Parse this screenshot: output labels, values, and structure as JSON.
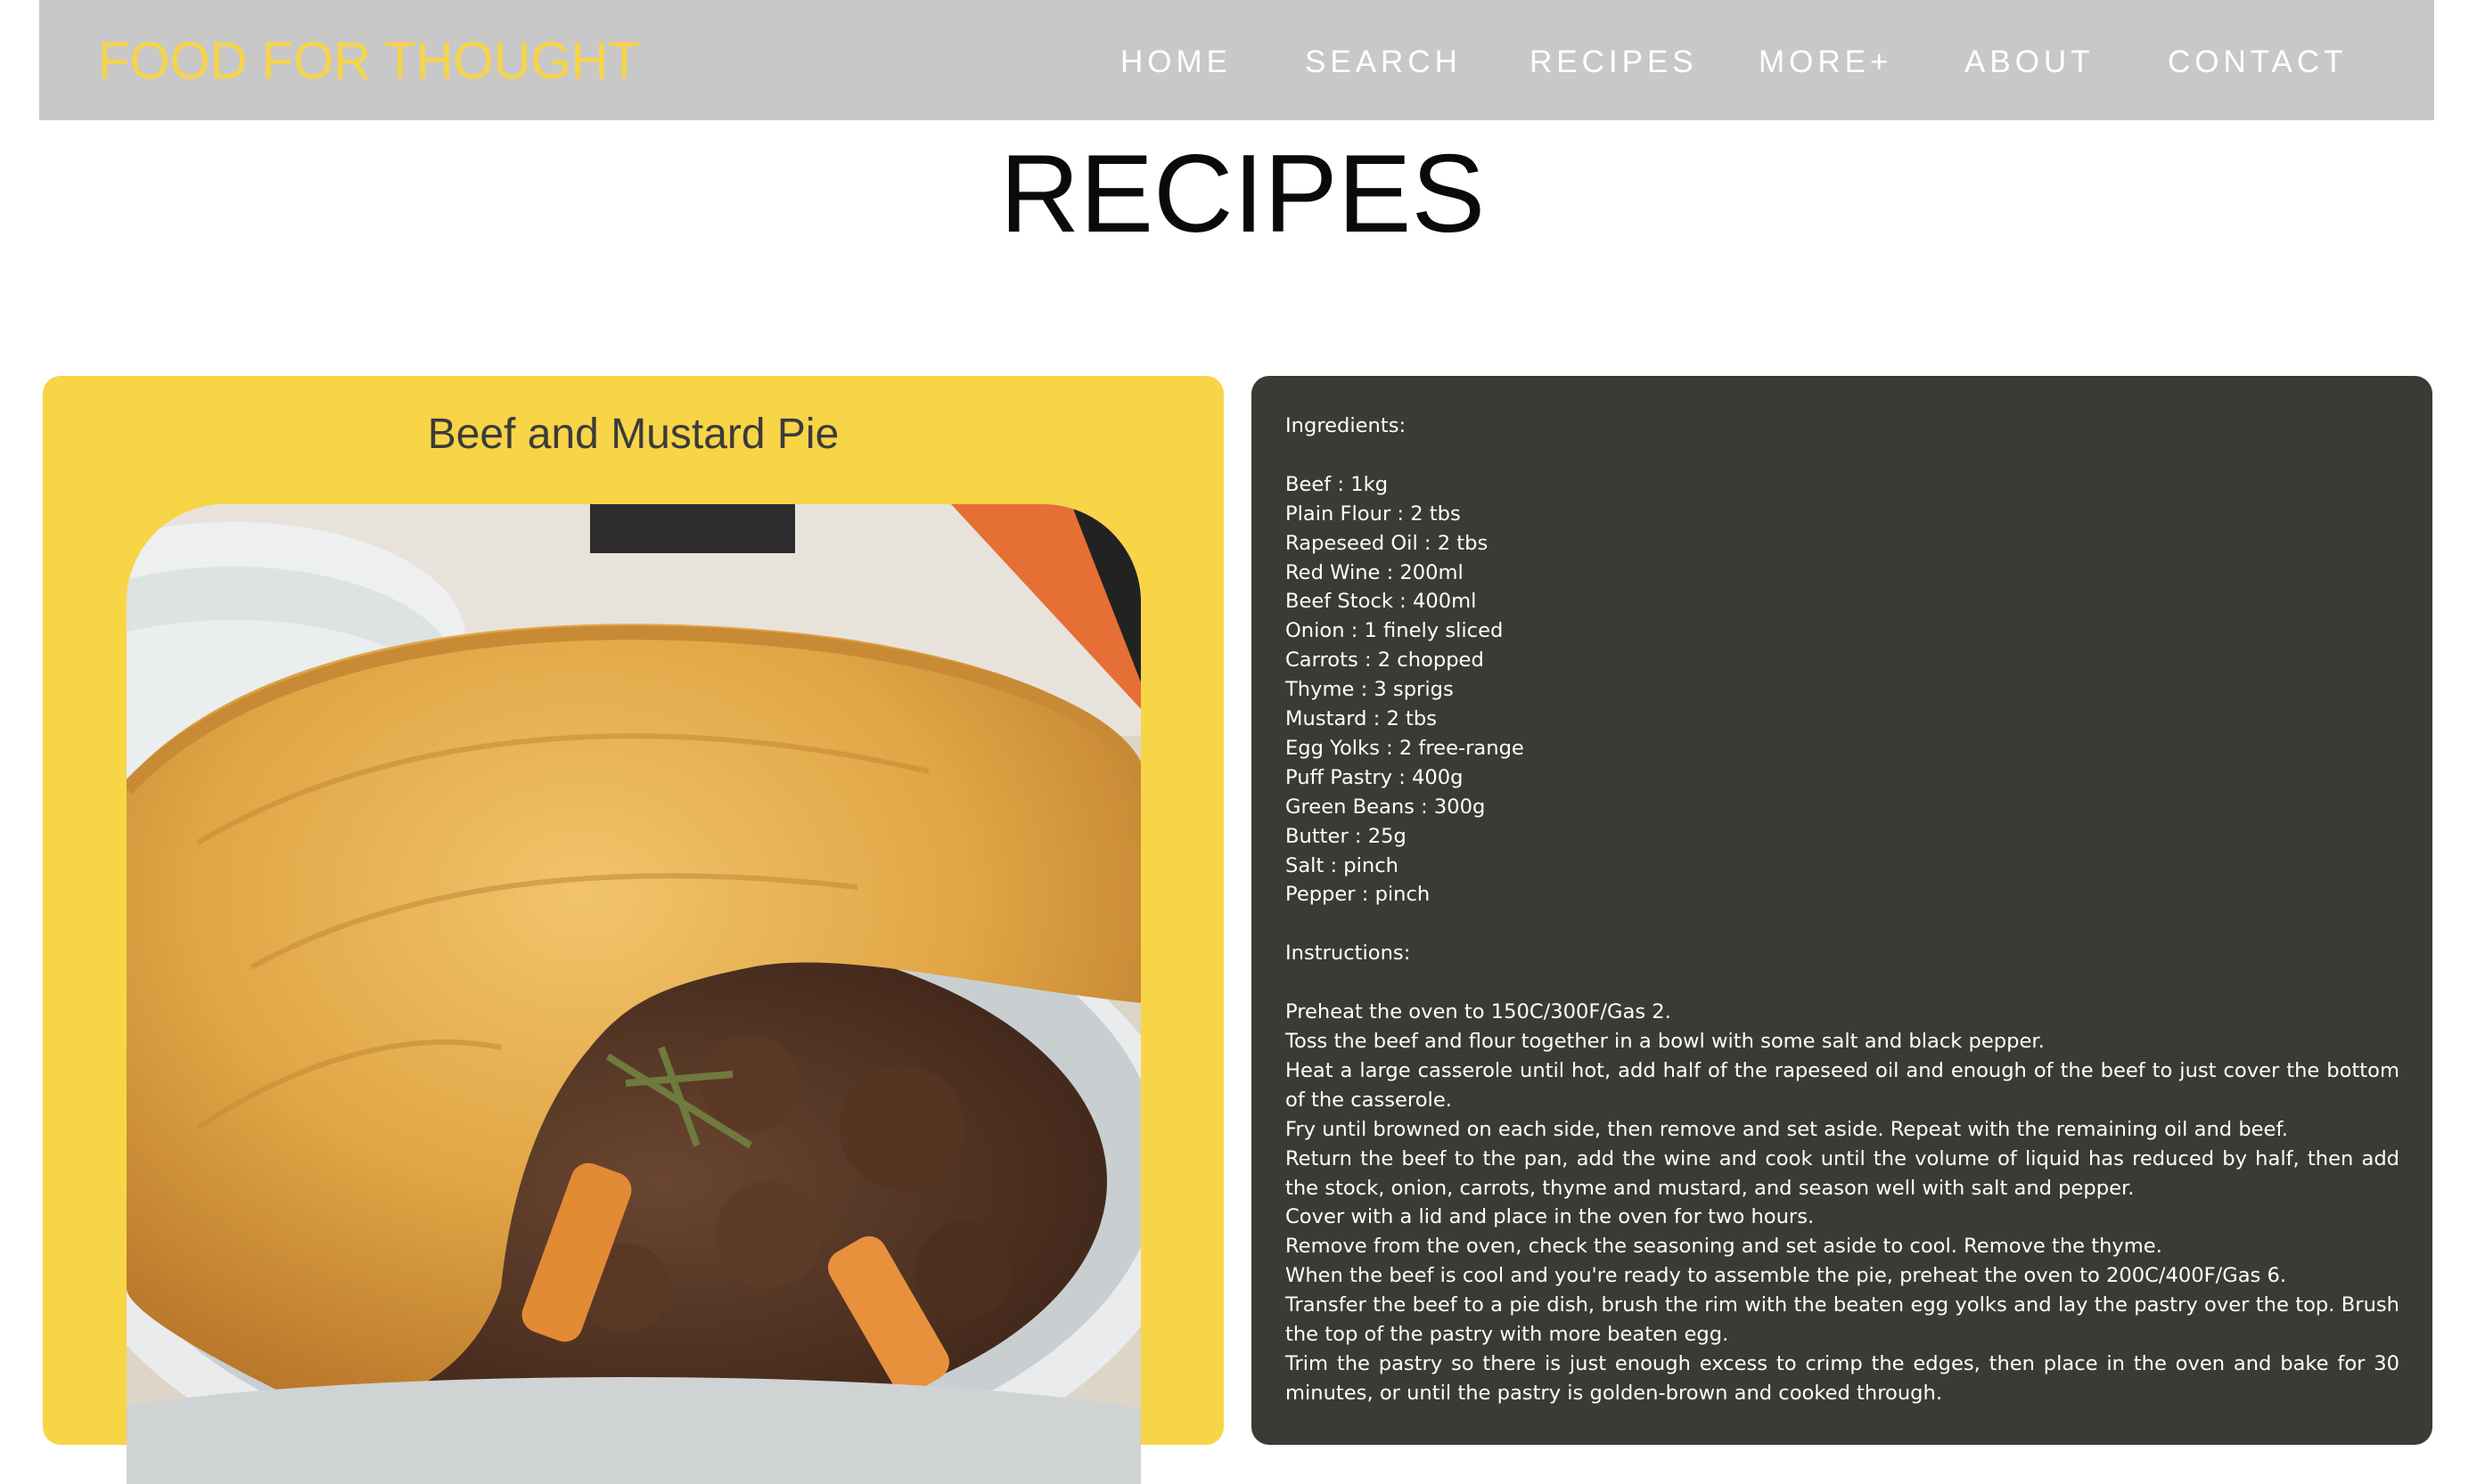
{
  "nav": {
    "brand": "FOOD FOR THOUGHT",
    "items": [
      "HOME",
      "SEARCH",
      "RECIPES",
      "MORE+",
      "ABOUT",
      "CONTACT"
    ]
  },
  "page_title": "RECIPES",
  "recipe": {
    "title": "Beef and Mustard Pie",
    "image_icon": "beef-pie-photo",
    "ingredients_heading": "Ingredients:",
    "ingredients": [
      "Beef : 1kg",
      "Plain Flour : 2 tbs",
      "Rapeseed Oil : 2 tbs",
      "Red Wine : 200ml",
      "Beef Stock : 400ml",
      "Onion : 1 finely sliced",
      "Carrots : 2 chopped",
      "Thyme : 3 sprigs",
      "Mustard : 2 tbs",
      "Egg Yolks : 2 free-range",
      "Puff Pastry : 400g",
      "Green Beans : 300g",
      "Butter : 25g",
      "Salt : pinch",
      "Pepper : pinch"
    ],
    "instructions_heading": "Instructions:",
    "instructions": [
      "Preheat the oven to 150C/300F/Gas 2.",
      "Toss the beef and flour together in a bowl with some salt and black pepper.",
      "Heat a large casserole until hot, add half of the rapeseed oil and enough of the beef to just cover the bottom of the casserole.",
      "Fry until browned on each side, then remove and set aside. Repeat with the remaining oil and beef.",
      "Return the beef to the pan, add the wine and cook until the volume of liquid has reduced by half, then add the stock, onion, carrots, thyme and mustard, and season well with salt and pepper.",
      "Cover with a lid and place in the oven for two hours.",
      "Remove from the oven, check the seasoning and set aside to cool. Remove the thyme.",
      "When the beef is cool and you're ready to assemble the pie, preheat the oven to 200C/400F/Gas 6.",
      "Transfer the beef to a pie dish, brush the rim with the beaten egg yolks and lay the pastry over the top. Brush the top of the pastry with more beaten egg.",
      "Trim the pastry so there is just enough excess to crimp the edges, then place in the oven and bake for 30 minutes, or until the pastry is golden-brown and cooked through."
    ]
  },
  "colors": {
    "nav_bg": "#c8c8c8",
    "brand": "#f7d447",
    "card_yellow": "#f8d447",
    "card_dark": "#3b3a34"
  }
}
